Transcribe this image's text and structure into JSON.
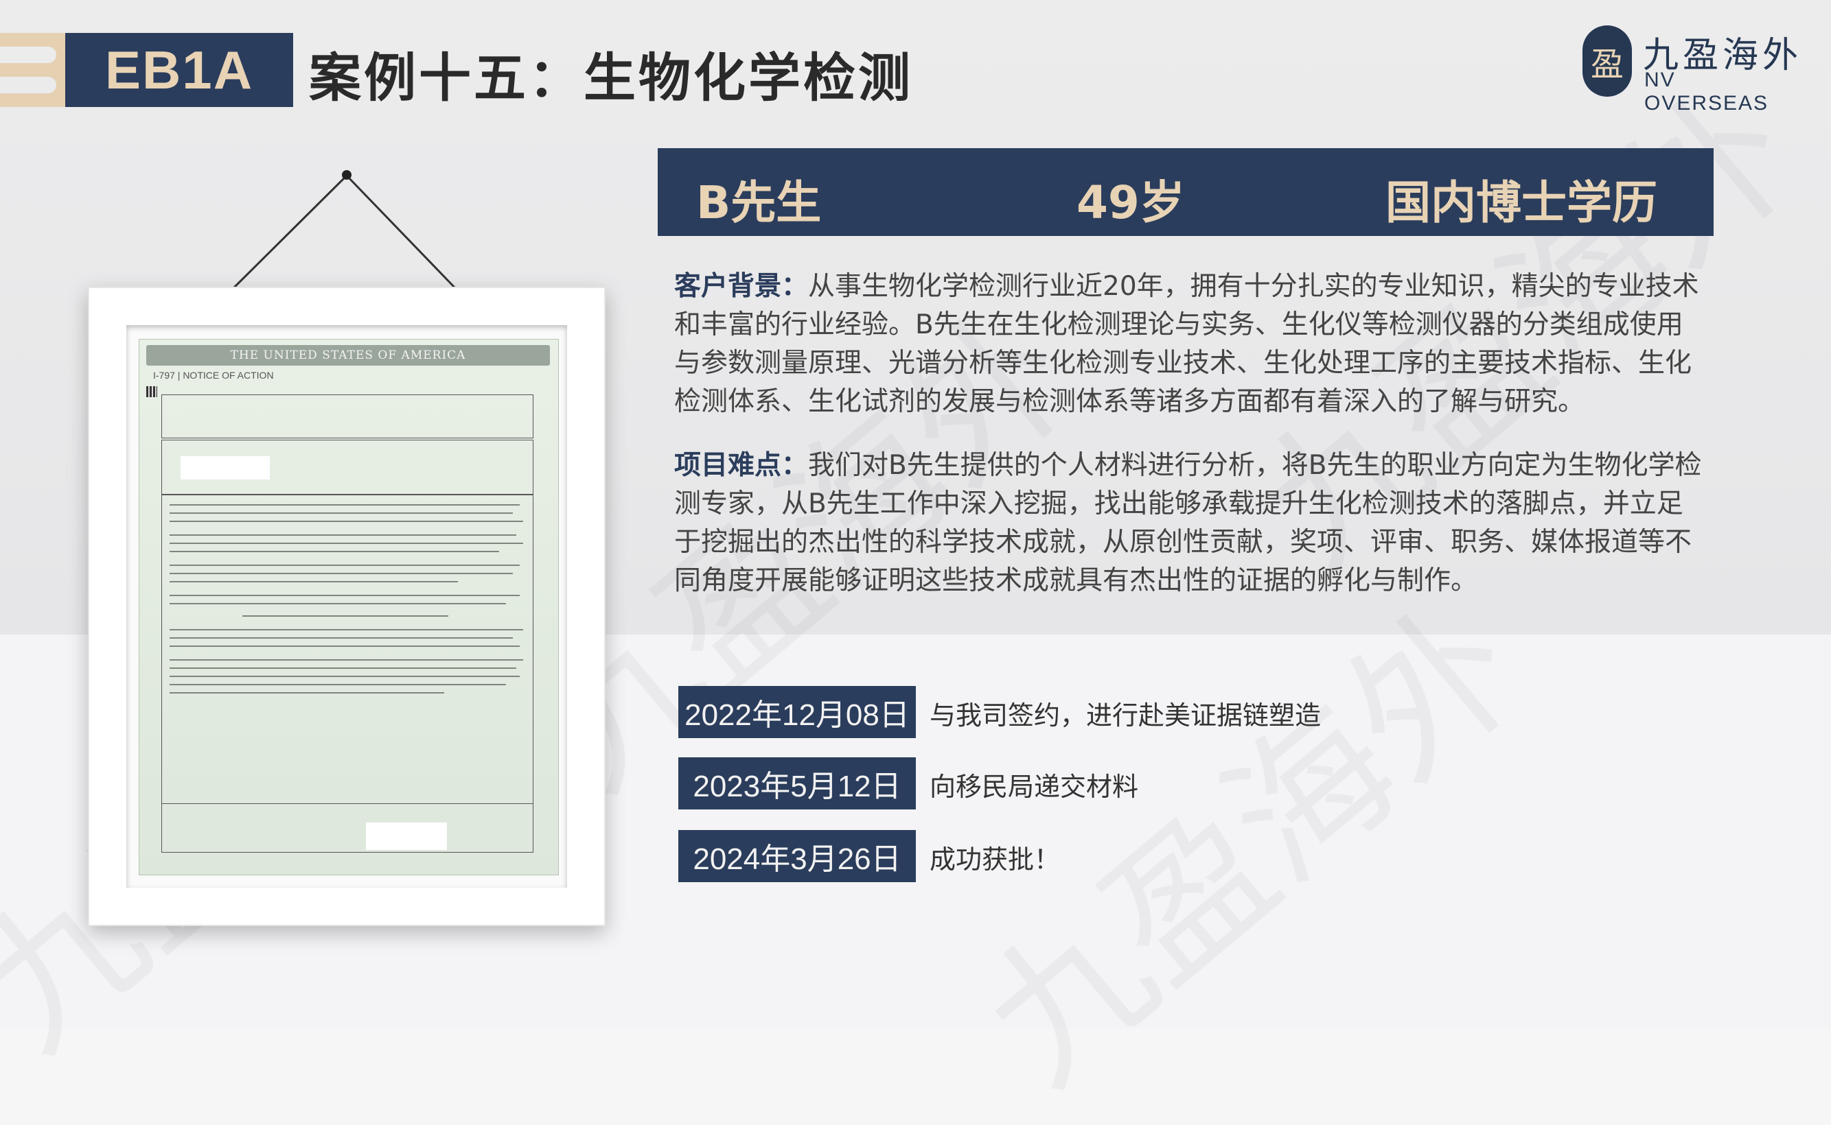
{
  "header": {
    "tag": "EB1A",
    "title": "案例十五：生物化学检测"
  },
  "logo": {
    "mark": "盈",
    "cn": "九盈海外",
    "en": "NV OVERSEAS"
  },
  "watermark": "九盈海外",
  "colors": {
    "navy": "#2b3d5c",
    "gold": "#e8d3b5",
    "tab": "#e6d0b2"
  },
  "certificate": {
    "banner": "THE UNITED STATES OF AMERICA",
    "subtitle": "I-797 | NOTICE OF ACTION"
  },
  "profile": {
    "name": "B先生",
    "age": "49岁",
    "education": "国内博士学历"
  },
  "background": {
    "label": "客户背景：",
    "text": "从事生物化学检测行业近20年，拥有十分扎实的专业知识，精尖的专业技术和丰富的行业经验。B先生在生化检测理论与实务、生化仪等检测仪器的分类组成使用与参数测量原理、光谱分析等生化检测专业技术、生化处理工序的主要技术指标、生化检测体系、生化试剂的发展与检测体系等诸多方面都有着深入的了解与研究。"
  },
  "difficulty": {
    "label": "项目难点：",
    "text": "我们对B先生提供的个人材料进行分析，将B先生的职业方向定为生物化学检测专家，从B先生工作中深入挖掘，找出能够承载提升生化检测技术的落脚点，并立足于挖掘出的杰出性的科学技术成就，从原创性贡献，奖项、评审、职务、媒体报道等不同角度开展能够证明这些技术成就具有杰出性的证据的孵化与制作。"
  },
  "timeline": [
    {
      "date": "2022年12月08日",
      "event": "与我司签约，进行赴美证据链塑造"
    },
    {
      "date": "2023年5月12日",
      "event": "向移民局递交材料"
    },
    {
      "date": "2024年3月26日",
      "event": "成功获批！"
    }
  ]
}
